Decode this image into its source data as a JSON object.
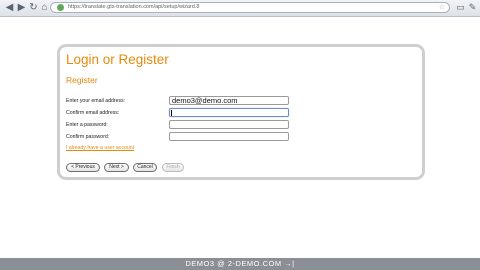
{
  "browser": {
    "url": "https://translate.gts-translation.com/api/setup/wizard.8",
    "back_glyph": "◀",
    "forward_glyph": "▶",
    "reload_glyph": "↻",
    "home_glyph": "⌂",
    "star_glyph": "☆",
    "page_glyph": "▭",
    "wrench_glyph": "✎"
  },
  "dialog": {
    "title": "Login or Register",
    "subtitle": "Register",
    "fields": [
      {
        "label": "Enter your email address:",
        "value": "demo3@demo.com"
      },
      {
        "label": "Confirm email address:",
        "value": ""
      },
      {
        "label": "Enter a password:",
        "value": ""
      },
      {
        "label": "Confirm password:",
        "value": ""
      }
    ],
    "existing_account_link": "I already have a user account",
    "buttons": {
      "previous": "< Previous",
      "next": "Next >",
      "cancel": "Cancel",
      "finish": "Finish"
    }
  },
  "caption": {
    "text": "DEMO3 @ 2-DEMO.COM →|"
  }
}
